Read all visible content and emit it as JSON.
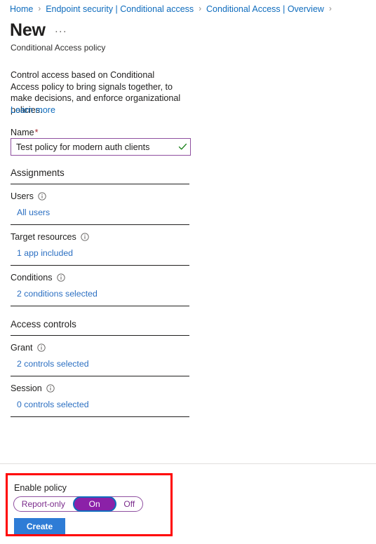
{
  "breadcrumb": {
    "separator": "›",
    "items": [
      {
        "label": "Home"
      },
      {
        "label": "Endpoint security | Conditional access"
      },
      {
        "label": "Conditional Access | Overview"
      }
    ],
    "trailing_separator": "›"
  },
  "header": {
    "title": "New",
    "more_menu": "···",
    "subtitle": "Conditional Access policy"
  },
  "intro": {
    "description": "Control access based on Conditional Access policy to bring signals together, to make decisions, and enforce organizational policies.",
    "learn_more": "Learn more"
  },
  "name_field": {
    "label": "Name",
    "required_marker": "*",
    "value": "Test policy for modern auth clients",
    "placeholder": "",
    "validation_icon": "checkmark-icon",
    "validation_color": "#107c10",
    "border_color": "#8f4fa0"
  },
  "sections": [
    {
      "heading": "Assignments",
      "fields": [
        {
          "label": "Users",
          "info": "info-icon",
          "value": "All users"
        },
        {
          "label": "Target resources",
          "info": "info-icon",
          "value": "1 app included"
        },
        {
          "label": "Conditions",
          "info": "info-icon",
          "value": "2 conditions selected"
        }
      ]
    },
    {
      "heading": "Access controls",
      "fields": [
        {
          "label": "Grant",
          "info": "info-icon",
          "value": "2 controls selected"
        },
        {
          "label": "Session",
          "info": "info-icon",
          "value": "0 controls selected"
        }
      ]
    }
  ],
  "footer": {
    "enable_label": "Enable policy",
    "toggle": {
      "options": [
        {
          "label": "Report-only",
          "selected": false
        },
        {
          "label": "On",
          "selected": true
        },
        {
          "label": "Off",
          "selected": false
        }
      ],
      "selected_value": "On",
      "selected_fill": "#8b21a8",
      "focus_ring": "#0f6cbd",
      "border_color": "#8f4fa0",
      "text_color": "#7b2c8c"
    },
    "create_button": "Create",
    "create_button_color": "#2e7cd6",
    "highlight_color": "#ff0000"
  },
  "colors": {
    "link": "#0f6cbd",
    "value_link": "#2b6fc2",
    "text": "#201f1e",
    "rule": "#201f1e",
    "required": "#a4262c"
  }
}
